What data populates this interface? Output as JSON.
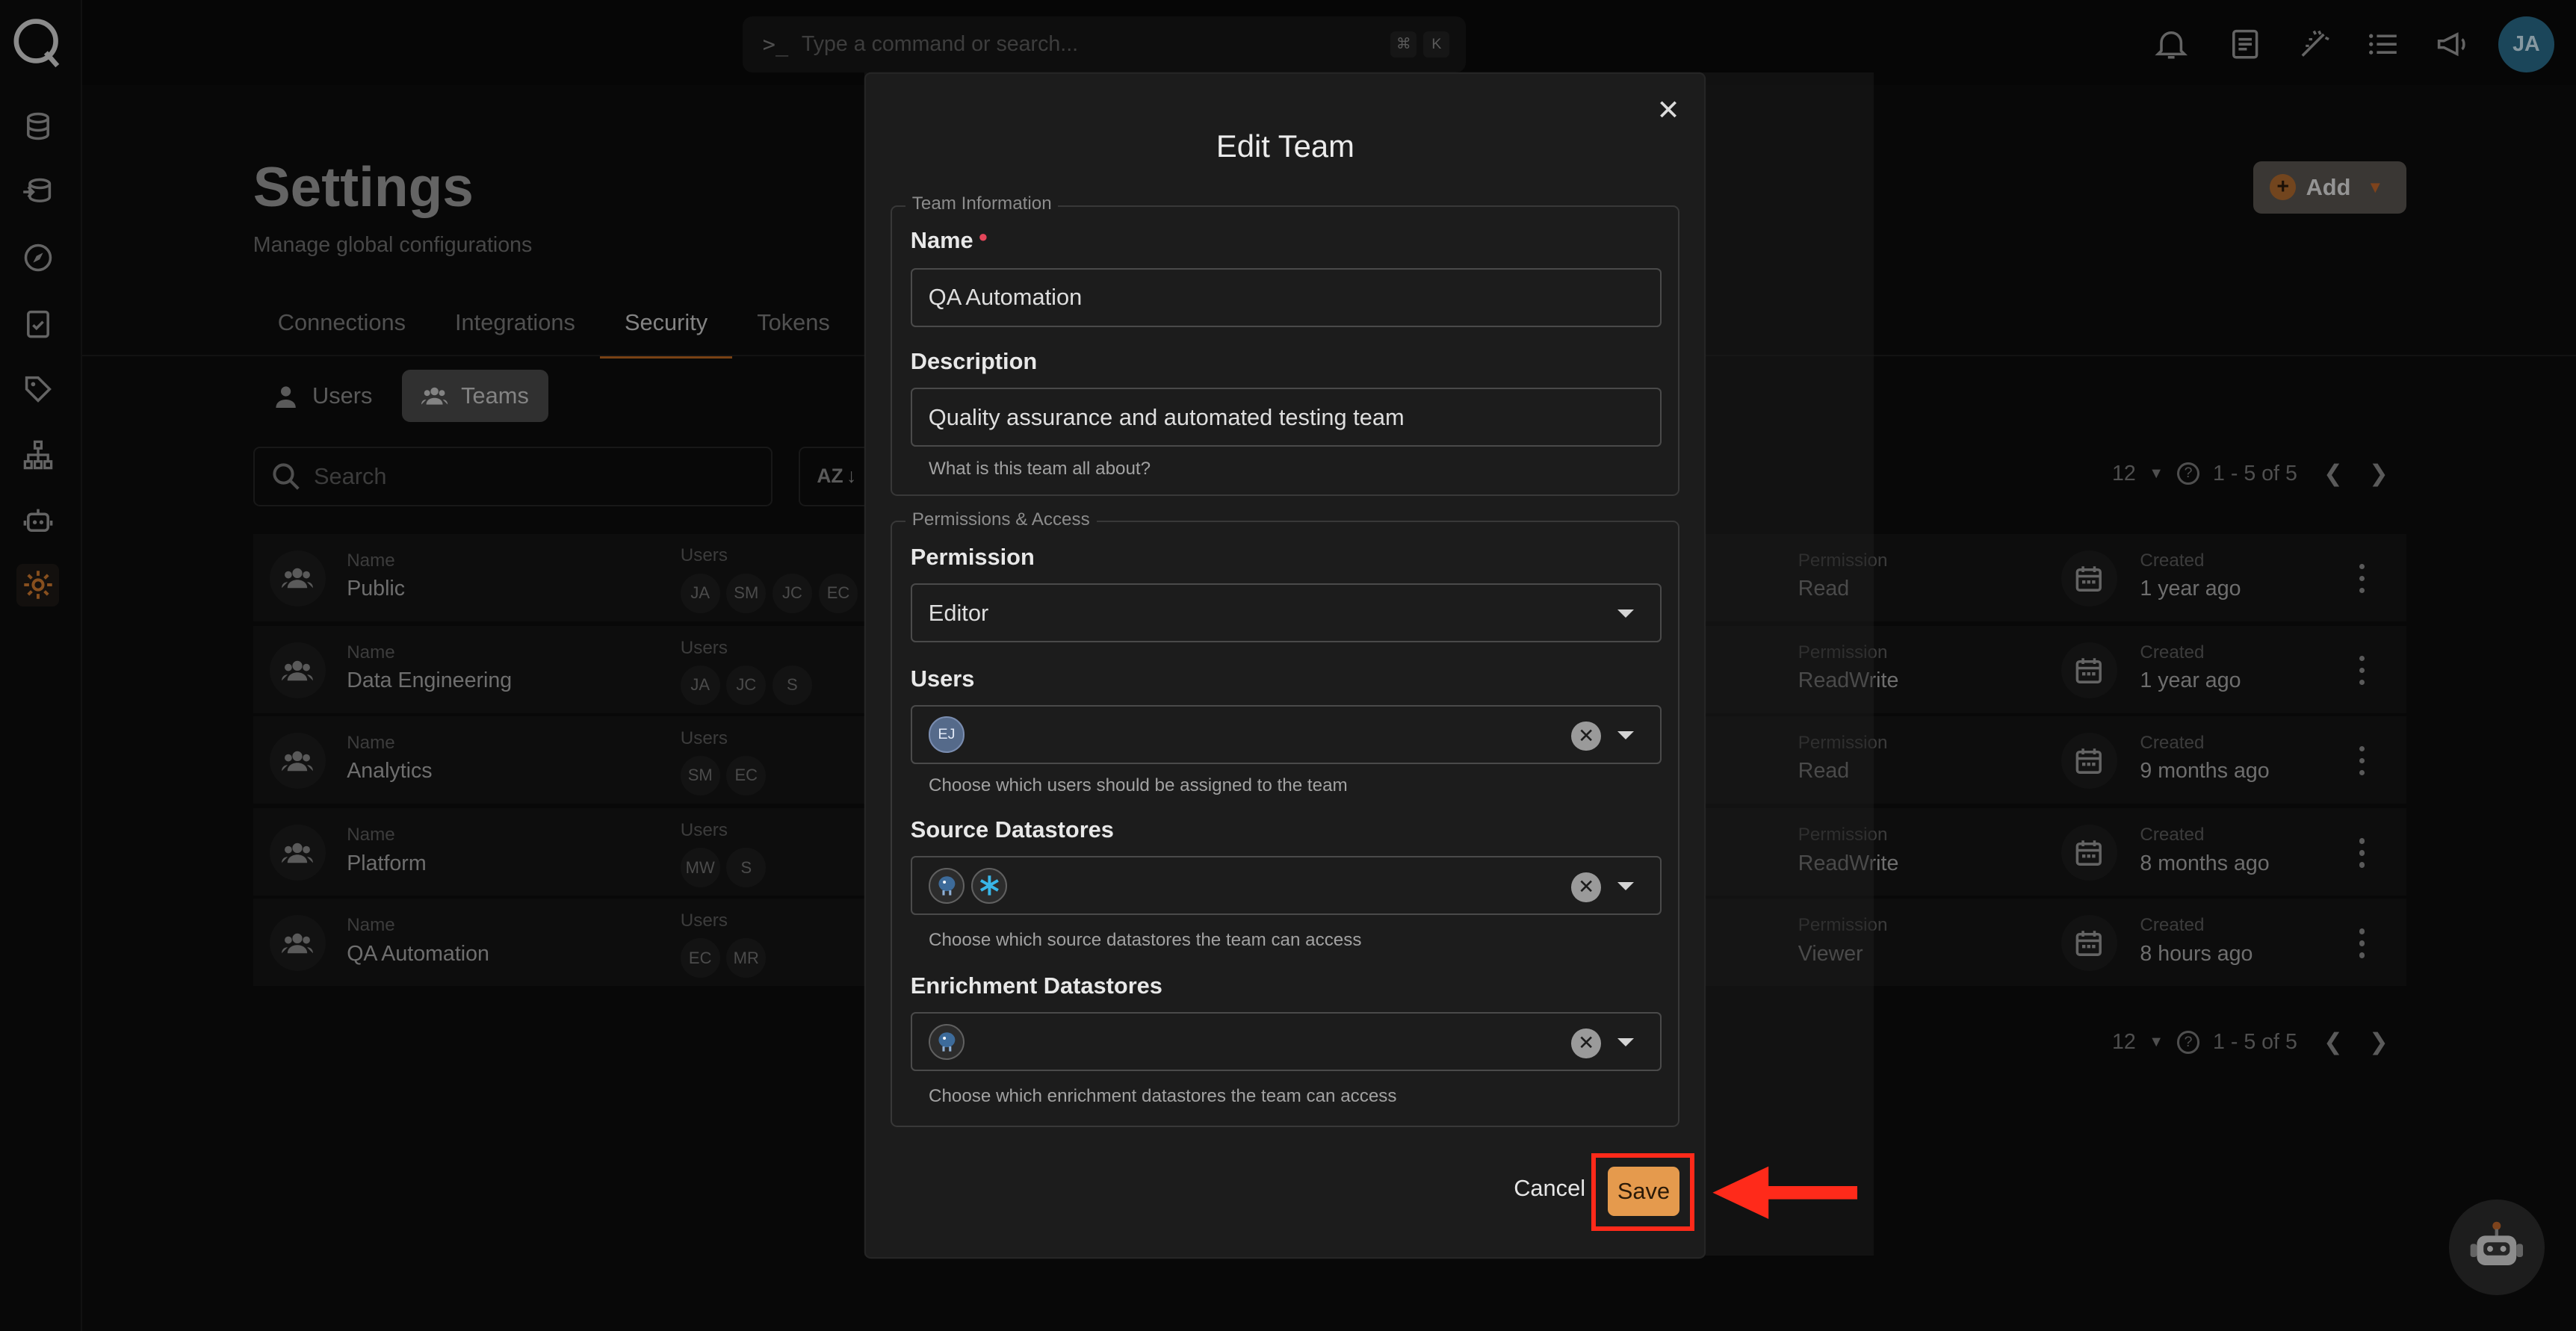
{
  "topbar": {
    "command_placeholder": "Type a command or search...",
    "shortcut_keys": [
      "⌘",
      "K"
    ],
    "avatar_initials": "JA"
  },
  "page": {
    "title": "Settings",
    "subtitle": "Manage global configurations",
    "add_label": "Add",
    "tabs": [
      "Connections",
      "Integrations",
      "Security",
      "Tokens"
    ],
    "active_tab": "Security",
    "subtabs": [
      "Users",
      "Teams"
    ],
    "active_subtab": "Teams",
    "search_placeholder": "Search",
    "sort_label": "AZ"
  },
  "pager": {
    "per_page": "12",
    "range": "1 - 5 of 5"
  },
  "labels": {
    "name": "Name",
    "users": "Users",
    "permission": "Permission",
    "created": "Created"
  },
  "teams": [
    {
      "name": "Public",
      "users": [
        "JA",
        "SM",
        "JC",
        "EC"
      ],
      "permission": "Read",
      "created": "1 year ago"
    },
    {
      "name": "Data Engineering",
      "users": [
        "JA",
        "JC",
        "S"
      ],
      "permission": "ReadWrite",
      "created": "1 year ago"
    },
    {
      "name": "Analytics",
      "users": [
        "SM",
        "EC"
      ],
      "permission": "Read",
      "created": "9 months ago"
    },
    {
      "name": "Platform",
      "users": [
        "MW",
        "S"
      ],
      "permission": "ReadWrite",
      "created": "8 months ago"
    },
    {
      "name": "QA Automation",
      "users": [
        "EC",
        "MR"
      ],
      "permission": "Viewer",
      "created": "8 hours ago"
    }
  ],
  "modal": {
    "title": "Edit Team",
    "team_info_legend": "Team Information",
    "name_label": "Name",
    "name_value": "QA Automation",
    "description_label": "Description",
    "description_value": "Quality assurance and automated testing team",
    "description_help": "What is this team all about?",
    "perm_legend": "Permissions & Access",
    "permission_label": "Permission",
    "permission_value": "Editor",
    "users_label": "Users",
    "users_selected": [
      "EJ"
    ],
    "users_help": "Choose which users should be assigned to the team",
    "source_label": "Source Datastores",
    "source_help": "Choose which source datastores the team can access",
    "enrichment_label": "Enrichment Datastores",
    "enrichment_help": "Choose which enrichment datastores the team can access",
    "cancel_label": "Cancel",
    "save_label": "Save"
  },
  "colors": {
    "accent": "#b8651f",
    "save": "#e59a4d",
    "highlight": "#ff2a1a"
  }
}
